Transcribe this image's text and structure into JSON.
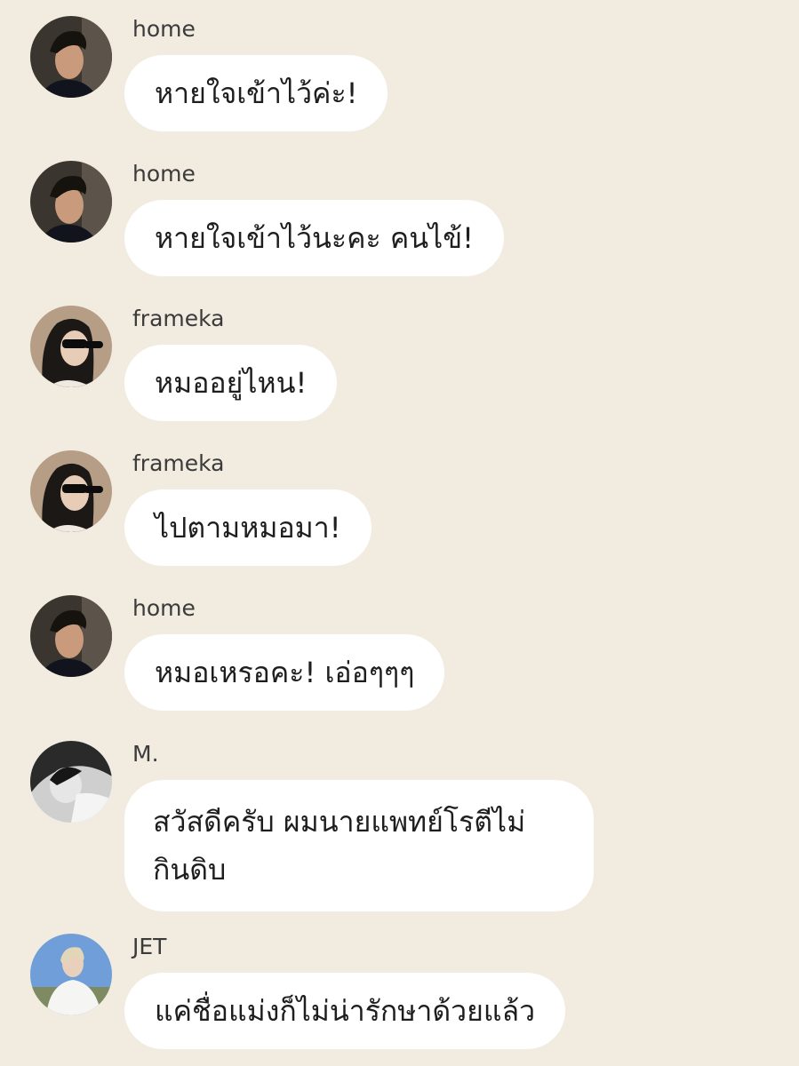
{
  "chat": {
    "messages": [
      {
        "sender": "home",
        "avatar": "home-avatar-icon",
        "text": "หายใจเข้าไว้ค่ะ!"
      },
      {
        "sender": "home",
        "avatar": "home-avatar-icon",
        "text": "หายใจเข้าไว้นะคะ คนไข้!"
      },
      {
        "sender": "frameka",
        "avatar": "frameka-avatar-icon",
        "text": "หมออยู่ไหน!"
      },
      {
        "sender": "frameka",
        "avatar": "frameka-avatar-icon",
        "text": "ไปตามหมอมา!"
      },
      {
        "sender": "home",
        "avatar": "home-avatar-icon",
        "text": "หมอเหรอคะ! เอ่อๆๆๆ"
      },
      {
        "sender": "M.",
        "avatar": "m-avatar-icon",
        "text": "สวัสดีครับ ผมนายแพทย์โรตีไม่กินดิบ"
      },
      {
        "sender": "JET",
        "avatar": "jet-avatar-icon",
        "text": "แค่ชื่อแม่งก็ไม่น่ารักษาด้วยแล้ว"
      }
    ]
  },
  "colors": {
    "background": "#f1ebe0",
    "bubble": "#ffffff",
    "text": "#1e1e1e",
    "sender": "#3b3b3b"
  }
}
